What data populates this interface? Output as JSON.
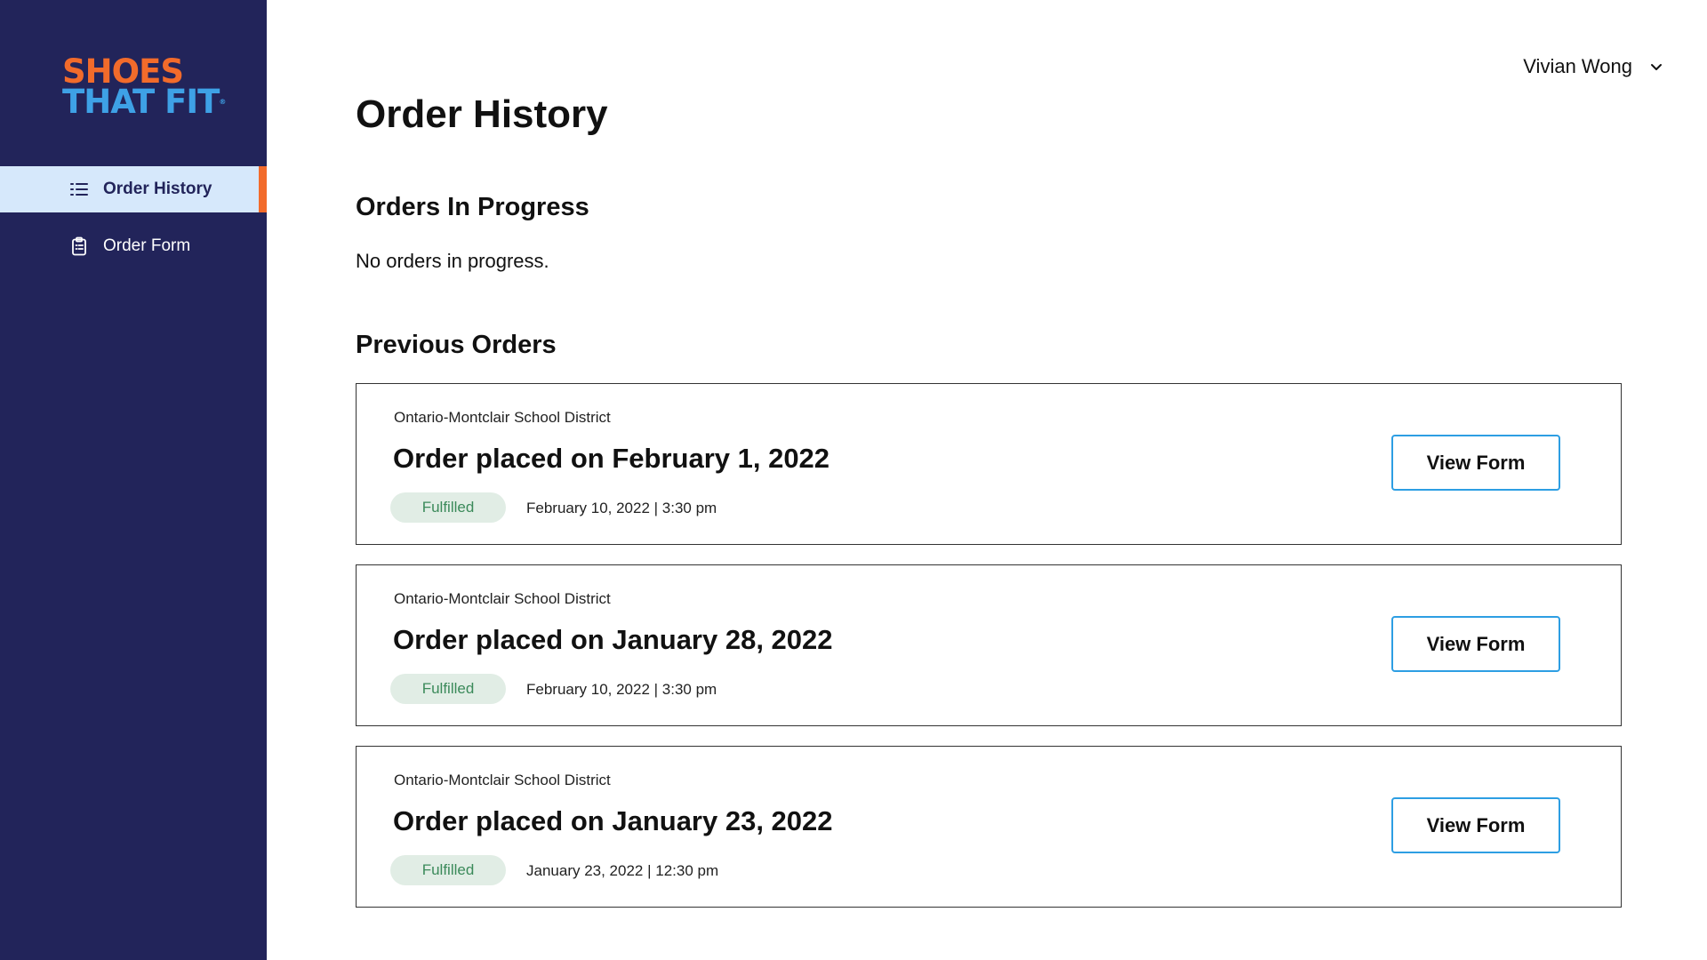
{
  "brand": {
    "logo_line1": "SHOES",
    "logo_line2": "THAT FIT",
    "reg_mark": "®",
    "orange": "#f26b2b",
    "blue": "#3ea1e6"
  },
  "sidebar": {
    "background": "#22245a",
    "items": [
      {
        "label": "Order History",
        "icon": "list-icon",
        "active": true
      },
      {
        "label": "Order Form",
        "icon": "clipboard-icon",
        "active": false
      }
    ]
  },
  "header": {
    "user_name": "Vivian Wong",
    "menu_icon": "chevron-down-icon"
  },
  "main": {
    "title": "Order History",
    "in_progress": {
      "heading": "Orders In Progress",
      "empty_text": "No orders in progress."
    },
    "previous": {
      "heading": "Previous Orders",
      "orders": [
        {
          "district": "Ontario-Montclair School District",
          "title": "Order placed on February 1, 2022",
          "status": "Fulfilled",
          "date": "February 10, 2022 | 3:30 pm",
          "button": "View Form"
        },
        {
          "district": "Ontario-Montclair School District",
          "title": "Order placed on January 28, 2022",
          "status": "Fulfilled",
          "date": "February 10, 2022 | 3:30 pm",
          "button": "View Form"
        },
        {
          "district": "Ontario-Montclair School District",
          "title": "Order placed on January 23, 2022",
          "status": "Fulfilled",
          "date": "January 23, 2022 | 12:30 pm",
          "button": "View Form"
        }
      ]
    }
  },
  "colors": {
    "active_nav_bg": "#d6e8fb",
    "active_indicator": "#f26b2b",
    "badge_bg": "#e1ede5",
    "badge_text": "#3b8a5a",
    "button_border": "#2d9ee3"
  }
}
